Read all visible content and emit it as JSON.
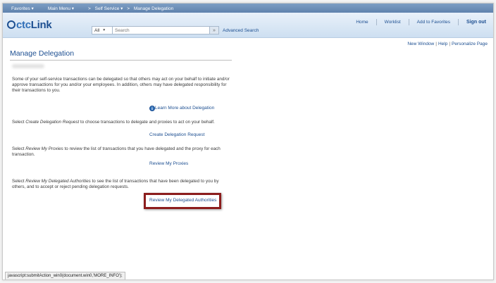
{
  "nav": {
    "favorites": "Favorites",
    "main_menu": "Main Menu",
    "breadcrumb_sep": ">",
    "self_service": "Self Service",
    "current_page": "Manage Delegation"
  },
  "header": {
    "logo_prefix": "ctc",
    "logo_suffix": "Link",
    "search_scope": "All",
    "search_placeholder": "Search",
    "search_go": "»",
    "advanced_search": "Advanced Search",
    "links": [
      "Home",
      "Worklist",
      "Add to Favorites",
      "Sign out"
    ]
  },
  "pagebar": {
    "new_window": "New Window",
    "help": "Help",
    "personalize": "Personalize Page",
    "pipe": "|"
  },
  "content": {
    "title": "Manage Delegation",
    "intro": "Some of your self-service transactions can be delegated so that others may act on your behalf to initiate and/or approve transactions for you and/or your employees. In addition, others may have delegated responsibility for their transactions to you.",
    "learn_more_icon": "i",
    "learn_more": "Learn More about Delegation",
    "create_text_pre": "Select ",
    "create_text_em": "Create Delegation Request",
    "create_text_post": " to choose transactions to delegate and proxies to act on your behalf.",
    "create_link": "Create Delegation Request",
    "review_text_pre": "Select ",
    "review_text_em": "Review My Proxies",
    "review_text_post": " to review the list of transactions that you have delegated and the proxy for each transaction.",
    "review_link": "Review My Proxies",
    "auth_text_pre": "Select ",
    "auth_text_em": "Review My Delegated Authorities",
    "auth_text_post": " to see the list of transactions that have been delegated to you by others, and to accept or reject pending delegation requests.",
    "auth_link": "Review My Delegated Authorities"
  },
  "status_bar": "javascript:submitAction_win0(document.win0,'MORE_INFO');"
}
